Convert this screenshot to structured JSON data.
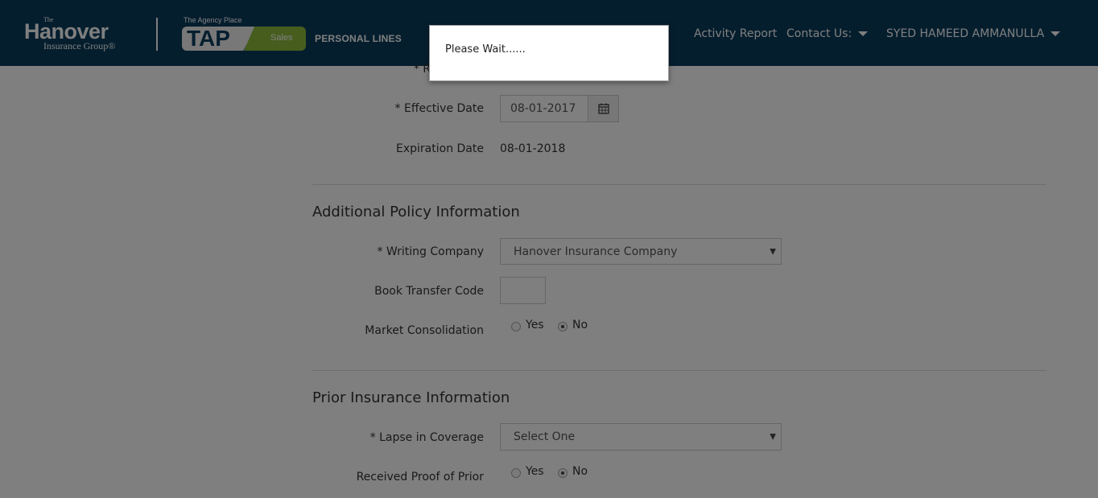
{
  "header": {
    "logo": {
      "the": "The",
      "name": "Hanover",
      "group": "Insurance Group®"
    },
    "tap": {
      "tagline": "The Agency Place",
      "name": "TAP",
      "sales": "Sales"
    },
    "section": "PERSONAL LINES",
    "nav": {
      "activity_report": "Activity Report",
      "contact_us": "Contact Us:",
      "user": "SYED HAMEED AMMANULLA"
    },
    "background_color": "#0b3c5d",
    "accent_color": "#8cbb3d"
  },
  "policy_dates": {
    "hidden_label_fragment": "* R",
    "effective_date": {
      "label": "* Effective Date",
      "value": "08-01-2017",
      "icon": "calendar-icon"
    },
    "expiration_date": {
      "label": "Expiration Date",
      "value": "08-01-2018"
    }
  },
  "additional_policy": {
    "title": "Additional Policy Information",
    "writing_company": {
      "label": "* Writing Company",
      "value": "Hanover Insurance Company"
    },
    "book_transfer_code": {
      "label": "Book Transfer Code",
      "value": ""
    },
    "market_consolidation": {
      "label": "Market Consolidation",
      "options": [
        "Yes",
        "No"
      ],
      "selected": "No"
    }
  },
  "prior_insurance": {
    "title": "Prior Insurance Information",
    "lapse_in_coverage": {
      "label": "* Lapse in Coverage",
      "value": "Select One"
    },
    "received_proof_of_prior": {
      "label": "Received Proof of Prior",
      "options": [
        "Yes",
        "No"
      ],
      "selected": "No"
    }
  },
  "modal": {
    "message": "Please Wait......"
  }
}
